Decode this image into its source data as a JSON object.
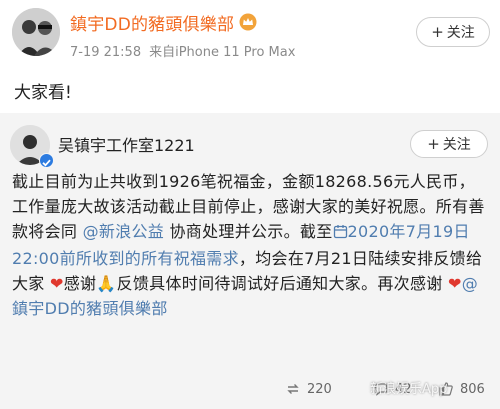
{
  "post": {
    "author": "鎮宇DD的豬頭俱樂部",
    "time": "7-19 21:58",
    "source": "来自iPhone 11 Pro Max",
    "follow_label": "关注",
    "text": "大家看!"
  },
  "repost": {
    "author": "吴镇宇工作室1221",
    "follow_label": "关注",
    "body_1": "截止目前为止共收到1926笔祝福金，金额18268.56元人民币，工作量庞大故该活动截止目前停止，感谢大家的美好祝愿。所有善款将会同",
    "link_sina": "@新浪公益",
    "body_2": "协商处理并公示。截至",
    "link_deadline": "2020年7月19日22:00前所收到的所有祝福需求",
    "body_3": "，均会在7月21日陆续安排反馈给大家",
    "body_4": "感谢",
    "body_5": "反馈具体时间待调试好后通知大家。再次感谢",
    "link_author": "@鎮宇DD的豬頭俱樂部"
  },
  "footer": {
    "reposts": "220",
    "comments": "42",
    "likes": "806"
  },
  "watermark": "新浪娱乐App",
  "colors": {
    "author_orange": "#f26b22",
    "link_blue": "#507daf",
    "heart_red": "#e0382e",
    "repost_bg": "#f4f4f4"
  }
}
